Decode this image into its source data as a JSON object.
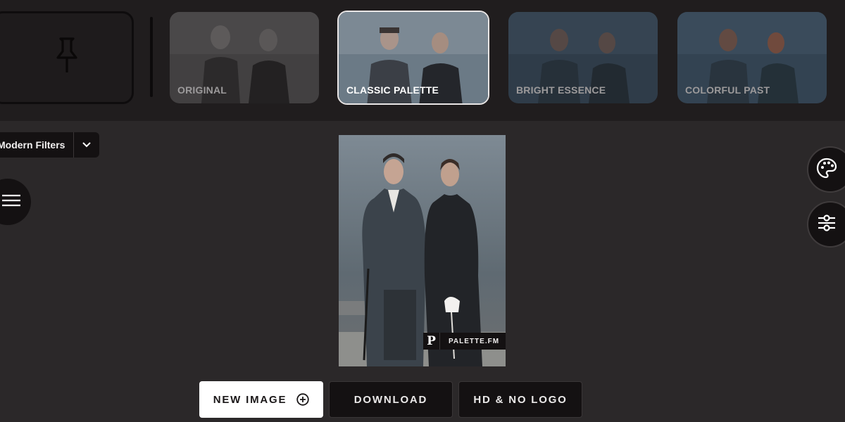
{
  "filters": {
    "tiles": [
      {
        "label": "ORIGINAL",
        "active": false
      },
      {
        "label": "CLASSIC PALETTE",
        "active": true
      },
      {
        "label": "BRIGHT ESSENCE",
        "active": false
      },
      {
        "label": "COLORFUL PAST",
        "active": false
      }
    ]
  },
  "toolbar": {
    "filter_dropdown_label": "Modern Filters"
  },
  "watermark": {
    "logo_letter": "P",
    "text": "PALETTE.FM"
  },
  "actions": {
    "new_image": "NEW IMAGE",
    "download": "DOWNLOAD",
    "hd_no_logo": "HD & NO LOGO"
  },
  "icons": {
    "pin": "pin-icon",
    "chevron": "chevron-down-icon",
    "menu": "hamburger-menu-icon",
    "palette": "palette-icon",
    "adjust": "sliders-icon",
    "add": "plus-circle-icon"
  },
  "colors": {
    "background": "#2b2829",
    "header_strip": "#201d1e",
    "button_dark": "#141112",
    "button_primary": "#ffffff"
  }
}
